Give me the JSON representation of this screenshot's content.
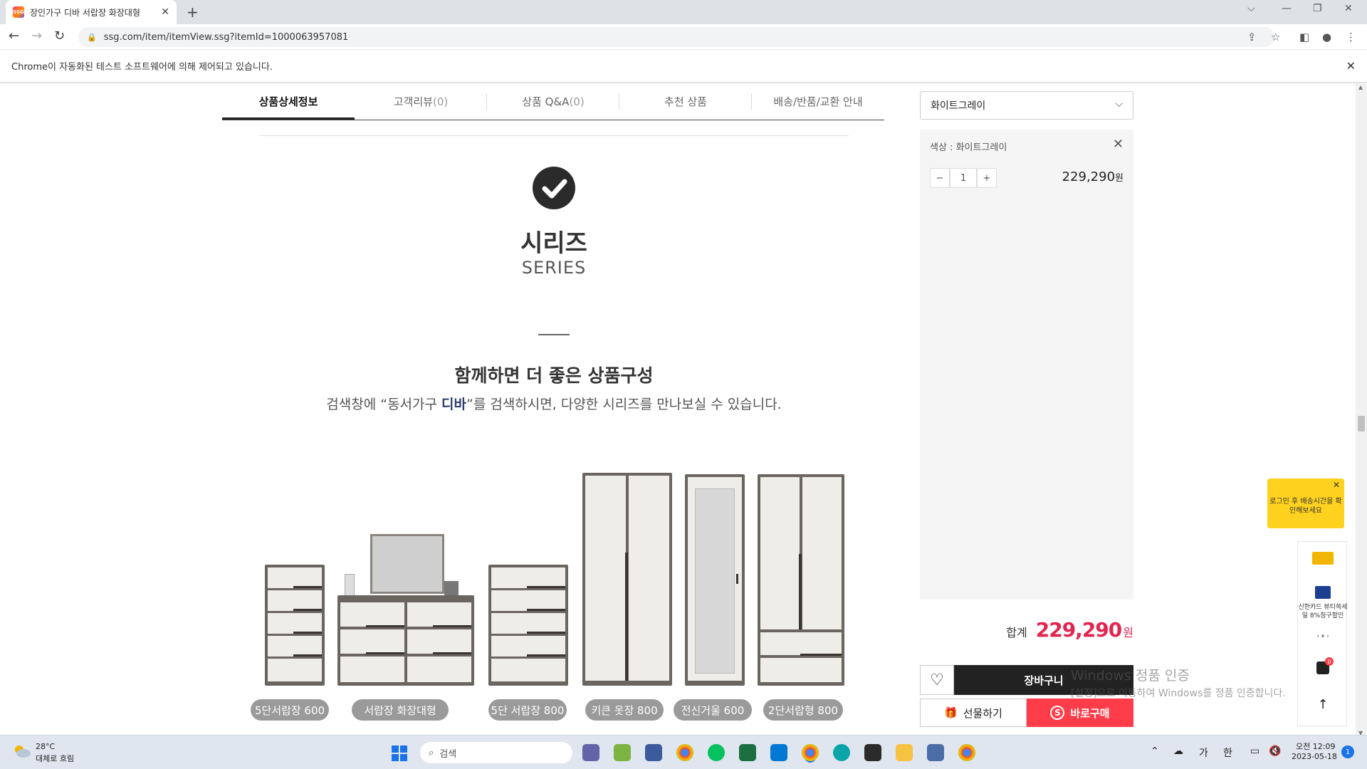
{
  "browser": {
    "tab_title": "장인가구 디바 서랍장 화장대형",
    "favicon_text": "SSG",
    "url": "ssg.com/item/itemView.ssg?itemId=1000063957081",
    "infobar": "Chrome이 자동화된 테스트 소프트웨어에 의해 제어되고 있습니다."
  },
  "product_tabs": [
    {
      "label": "상품상세정보",
      "count": ""
    },
    {
      "label": "고객리뷰",
      "count": "(0)"
    },
    {
      "label": "상품 Q&A",
      "count": "(0)"
    },
    {
      "label": "추천 상품",
      "count": ""
    },
    {
      "label": "배송/반품/교환 안내",
      "count": ""
    }
  ],
  "content": {
    "series_title": "시리즈",
    "series_sub": "SERIES",
    "combo_title": "함께하면 더 좋은 상품구성",
    "combo_desc_pre": "검색창에 “동서가구 ",
    "combo_desc_hl": "디바",
    "combo_desc_post": "”를 검색하시면, 다양한 시리즈를 만나보실 수 있습니다."
  },
  "series_items": [
    "5단서랍장 600",
    "서랍장 화장대형",
    "5단 서랍장 800",
    "키큰 옷장 800",
    "전신거울 600",
    "2단서랍형 800"
  ],
  "purchase": {
    "option_selected": "화이트그레이",
    "option_label": "색상 : 화이트그레이",
    "minus": "−",
    "quantity": "1",
    "plus": "+",
    "option_price": "229,290",
    "won": "원",
    "total_label": "합계",
    "total_price": "229,290",
    "cart_label": "장바구니",
    "gift_label": "선물하기",
    "buy_label": "바로구매",
    "buy_logo": "S"
  },
  "float_panel": {
    "tooltip": "로그인 후 배송시간을 확인해보세요",
    "card_text": "신한카드 뷰티쓱세일 8%청구할인",
    "card_nav": "‹  ⏸  ›",
    "bag_badge": "0"
  },
  "watermark": {
    "line1": "Windows 정품 인증",
    "line2": "[설정]으로 이동하여 Windows를 정품 인증합니다."
  },
  "taskbar": {
    "temperature": "28°C",
    "weather": "대체로 흐림",
    "search": "검색",
    "ime_1": "가",
    "ime_2": "한",
    "time": "오전 12:09",
    "date": "2023-05-18",
    "notification_count": "1"
  }
}
